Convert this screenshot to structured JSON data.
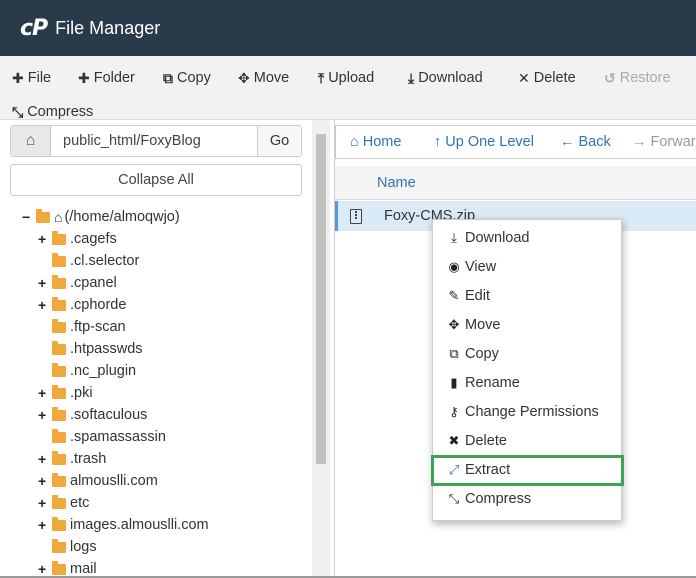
{
  "header": {
    "logo": "cP",
    "title": "File Manager"
  },
  "toolbar": {
    "file": "File",
    "folder": "Folder",
    "copy": "Copy",
    "move": "Move",
    "upload": "Upload",
    "download": "Download",
    "delete": "Delete",
    "restore": "Restore",
    "compress": "Compress"
  },
  "left": {
    "path_value": "public_html/FoxyBlog",
    "go_label": "Go",
    "collapse_label": "Collapse All",
    "root_label": "(/home/almoqwjo)",
    "tree": [
      {
        "label": ".cagefs",
        "expandable": "+"
      },
      {
        "label": ".cl.selector",
        "expandable": ""
      },
      {
        "label": ".cpanel",
        "expandable": "+"
      },
      {
        "label": ".cphorde",
        "expandable": "+"
      },
      {
        "label": ".ftp-scan",
        "expandable": ""
      },
      {
        "label": ".htpasswds",
        "expandable": ""
      },
      {
        "label": ".nc_plugin",
        "expandable": ""
      },
      {
        "label": ".pki",
        "expandable": "+"
      },
      {
        "label": ".softaculous",
        "expandable": "+"
      },
      {
        "label": ".spamassassin",
        "expandable": ""
      },
      {
        "label": ".trash",
        "expandable": "+"
      },
      {
        "label": "almouslli.com",
        "expandable": "+"
      },
      {
        "label": "etc",
        "expandable": "+"
      },
      {
        "label": "images.almouslli.com",
        "expandable": "+"
      },
      {
        "label": "logs",
        "expandable": ""
      },
      {
        "label": "mail",
        "expandable": "+"
      }
    ]
  },
  "right": {
    "nav": {
      "home": "Home",
      "up": "Up One Level",
      "back": "Back",
      "forward": "Forward"
    },
    "column_name": "Name",
    "file_name": "Foxy-CMS.zip"
  },
  "context_menu": [
    {
      "label": "Download",
      "icon": "download-icon"
    },
    {
      "label": "View",
      "icon": "eye-icon"
    },
    {
      "label": "Edit",
      "icon": "pencil-icon"
    },
    {
      "label": "Move",
      "icon": "move-icon"
    },
    {
      "label": "Copy",
      "icon": "copy-icon"
    },
    {
      "label": "Rename",
      "icon": "file-icon"
    },
    {
      "label": "Change Permissions",
      "icon": "key-icon"
    },
    {
      "label": "Delete",
      "icon": "times-icon"
    },
    {
      "label": "Extract",
      "icon": "expand-icon"
    },
    {
      "label": "Compress",
      "icon": "compress-icon"
    }
  ],
  "colors": {
    "header_bg": "#293a4a",
    "link": "#2f74b5",
    "folder": "#f0a93a",
    "highlight": "#3ea355",
    "selected_row": "#dbeaf7"
  }
}
